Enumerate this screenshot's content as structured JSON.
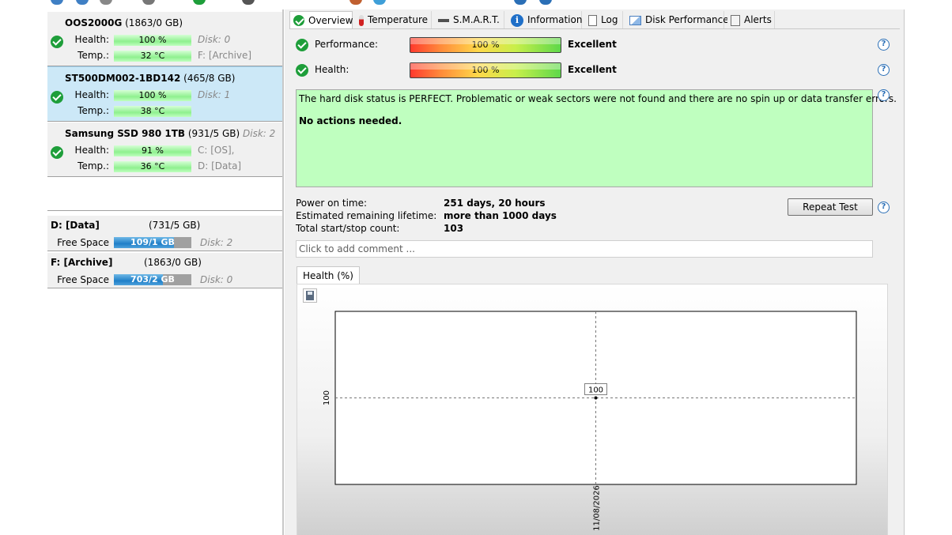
{
  "left": {
    "disks": [
      {
        "name": "OOS2000G",
        "size": "(1863/0 GB)",
        "title_extra": "",
        "health_label": "Health:",
        "health": "100 %",
        "health_side": "Disk: 0",
        "temp_label": "Temp.:",
        "temp": "32 °C",
        "temp_side": "F: [Archive]",
        "selected": false
      },
      {
        "name": "ST500DM002-1BD142",
        "size": "(465/8 GB)",
        "title_extra": "",
        "health_label": "Health:",
        "health": "100 %",
        "health_side": "Disk: 1",
        "temp_label": "Temp.:",
        "temp": "38 °C",
        "temp_side": "",
        "selected": true
      },
      {
        "name": "Samsung SSD 980 1TB",
        "size": "(931/5 GB)",
        "title_extra": "Disk: 2",
        "health_label": "Health:",
        "health": "91 %",
        "health_side": "C: [OS],",
        "temp_label": "Temp.:",
        "temp": "36 °C",
        "temp_side": "D: [Data]",
        "selected": false
      }
    ],
    "partitions": [
      {
        "name": "D: [Data]",
        "size": "(731/5 GB)",
        "label": "Free Space",
        "free": "109/1 GB",
        "free_fraction": 0.149,
        "disk": "Disk: 2"
      },
      {
        "name": "F: [Archive]",
        "size": "(1863/0 GB)",
        "label": "Free Space",
        "free": "703/2 GB",
        "free_fraction": 0.377,
        "disk": "Disk: 0"
      }
    ]
  },
  "tabs": [
    {
      "label": "Overview",
      "icon": "check-icon",
      "active": true
    },
    {
      "label": "Temperature",
      "icon": "thermometer-icon",
      "active": false
    },
    {
      "label": "S.M.A.R.T.",
      "icon": "smart-icon",
      "active": false
    },
    {
      "label": "Information",
      "icon": "info-icon",
      "active": false
    },
    {
      "label": "Log",
      "icon": "document-icon",
      "active": false
    },
    {
      "label": "Disk Performance",
      "icon": "chart-icon",
      "active": false
    },
    {
      "label": "Alerts",
      "icon": "alerts-icon",
      "active": false
    }
  ],
  "overview": {
    "performance": {
      "label": "Performance:",
      "bar": "100 %",
      "value": "Excellent"
    },
    "health": {
      "label": "Health:",
      "bar": "100 %",
      "value": "Excellent"
    },
    "message_line1": "The hard disk status is PERFECT. Problematic or weak sectors were not found and there are no spin up or data transfer errors.",
    "message_line2": "No actions needed.",
    "power_on_label": "Power on time:",
    "power_on_value": "251 days, 20 hours",
    "lifetime_label": "Estimated remaining lifetime:",
    "lifetime_value": "more than 1000 days",
    "startstop_label": "Total start/stop count:",
    "startstop_value": "103",
    "repeat_test_label": "Repeat Test",
    "comment_placeholder": "Click to add comment ...",
    "help_symbol": "?"
  },
  "chart_tab_label": "Health (%)",
  "chart_data": {
    "type": "line",
    "x": [
      "11/08/2026"
    ],
    "values": [
      100
    ],
    "point_labels": [
      "100"
    ],
    "ytick_labels": [
      "100"
    ],
    "grid": true
  },
  "colors": {
    "ok_green": "#1e9e3a",
    "message_bg": "#bfffbf",
    "selected_disk_bg": "#cce8f7",
    "partition_fill": "#1f7fc8",
    "help_blue": "#2b6fb6"
  }
}
